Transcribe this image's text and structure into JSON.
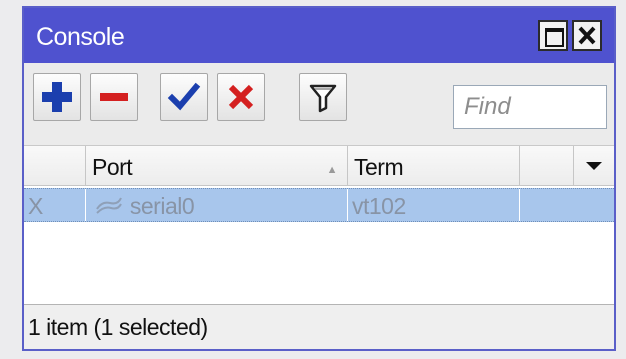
{
  "window": {
    "title": "Console"
  },
  "toolbar": {
    "add": "add-icon",
    "remove": "remove-icon",
    "enable": "checkmark-icon",
    "disable": "x-icon",
    "filter": "filter-icon",
    "find_placeholder": "Find"
  },
  "table": {
    "columns": [
      "",
      "Port",
      "Term",
      ""
    ],
    "rows": [
      {
        "flag": "X",
        "port": "serial0",
        "term": "vt102"
      }
    ]
  },
  "status": {
    "text": "1 item (1 selected)"
  },
  "colors": {
    "titlebar": "#4f52cf",
    "selected_row": "#a8c6ec",
    "add_icon": "#1b3fae",
    "remove_icon": "#d42020",
    "check_icon": "#1b3fae",
    "x_icon": "#d42020"
  }
}
